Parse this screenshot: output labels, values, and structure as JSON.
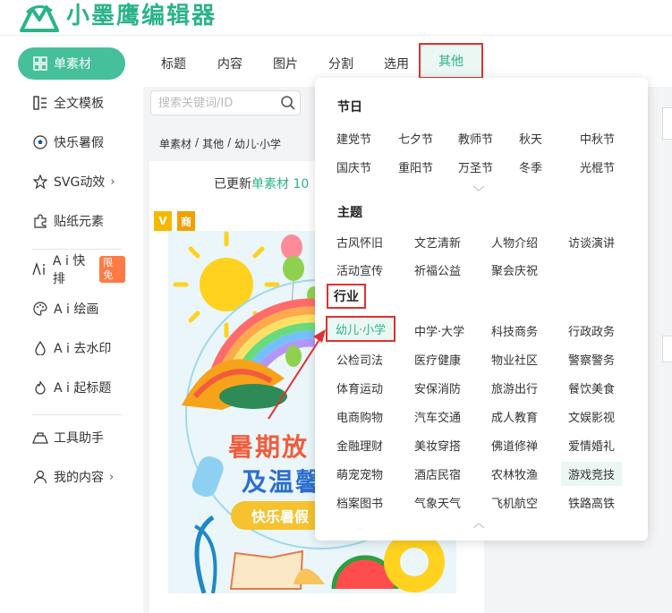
{
  "app": {
    "name": "小墨鹰编辑器"
  },
  "sidebar": {
    "items": [
      {
        "label": "单素材",
        "icon": "grid-icon",
        "active": true
      },
      {
        "label": "全文模板",
        "icon": "template-icon"
      },
      {
        "label": "快乐暑假",
        "icon": "soccer-ball-icon"
      },
      {
        "label": "SVG动效",
        "icon": "star-icon",
        "chevron": "›"
      },
      {
        "label": "贴纸元素",
        "icon": "puzzle-icon"
      },
      {
        "label": "A i 快排",
        "icon": "ai-icon",
        "badge": "限免"
      },
      {
        "label": "A i 绘画",
        "icon": "palette-icon"
      },
      {
        "label": "A i 去水印",
        "icon": "drop-icon"
      },
      {
        "label": "A i 起标题",
        "icon": "flame-icon"
      },
      {
        "label": "工具助手",
        "icon": "tool-icon"
      },
      {
        "label": "我的内容",
        "icon": "user-icon",
        "chevron": "›"
      }
    ]
  },
  "tabs": [
    "标题",
    "内容",
    "图片",
    "分割",
    "选用",
    "其他"
  ],
  "active_tab": "其他",
  "search": {
    "placeholder": "搜索关键词/ID"
  },
  "breadcrumb": [
    "单素材",
    "/",
    "其他",
    "/",
    "幼儿·小学"
  ],
  "updated": {
    "prefix": "已更新",
    "link": "单素材",
    "count": "10"
  },
  "card": {
    "tag_v": "V",
    "tag_s": "商",
    "title_line1": "暑期放",
    "title_line2": "及温馨",
    "button": "快乐暑假"
  },
  "dropdown": {
    "sections": [
      {
        "title": "节日",
        "rows": [
          [
            "建党节",
            "七夕节",
            "教师节",
            "秋天",
            "中秋节"
          ],
          [
            "国庆节",
            "重阳节",
            "万圣节",
            "冬季",
            "光棍节"
          ]
        ]
      },
      {
        "title": "主题",
        "rows": [
          [
            "古风怀旧",
            "文艺清新",
            "人物介绍",
            "访谈演讲"
          ],
          [
            "活动宣传",
            "祈福公益",
            "聚会庆祝"
          ]
        ]
      },
      {
        "title": "行业",
        "selected": "幼儿·小学",
        "highlighted": "游戏竞技",
        "rows": [
          [
            "幼儿·小学",
            "中学·大学",
            "科技商务",
            "行政政务"
          ],
          [
            "公检司法",
            "医疗健康",
            "物业社区",
            "警察警务"
          ],
          [
            "体育运动",
            "安保消防",
            "旅游出行",
            "餐饮美食"
          ],
          [
            "电商购物",
            "汽车交通",
            "成人教育",
            "文娱影视"
          ],
          [
            "金融理财",
            "美妆穿搭",
            "佛道修禅",
            "爱情婚礼"
          ],
          [
            "萌宠宠物",
            "酒店民宿",
            "农林牧渔",
            "游戏竞技"
          ],
          [
            "档案图书",
            "气象天气",
            "飞机航空",
            "铁路高铁"
          ]
        ]
      }
    ]
  },
  "colors": {
    "brand": "#2bb38a",
    "active_bg": "#45c09a",
    "annotation": "#e03030"
  }
}
